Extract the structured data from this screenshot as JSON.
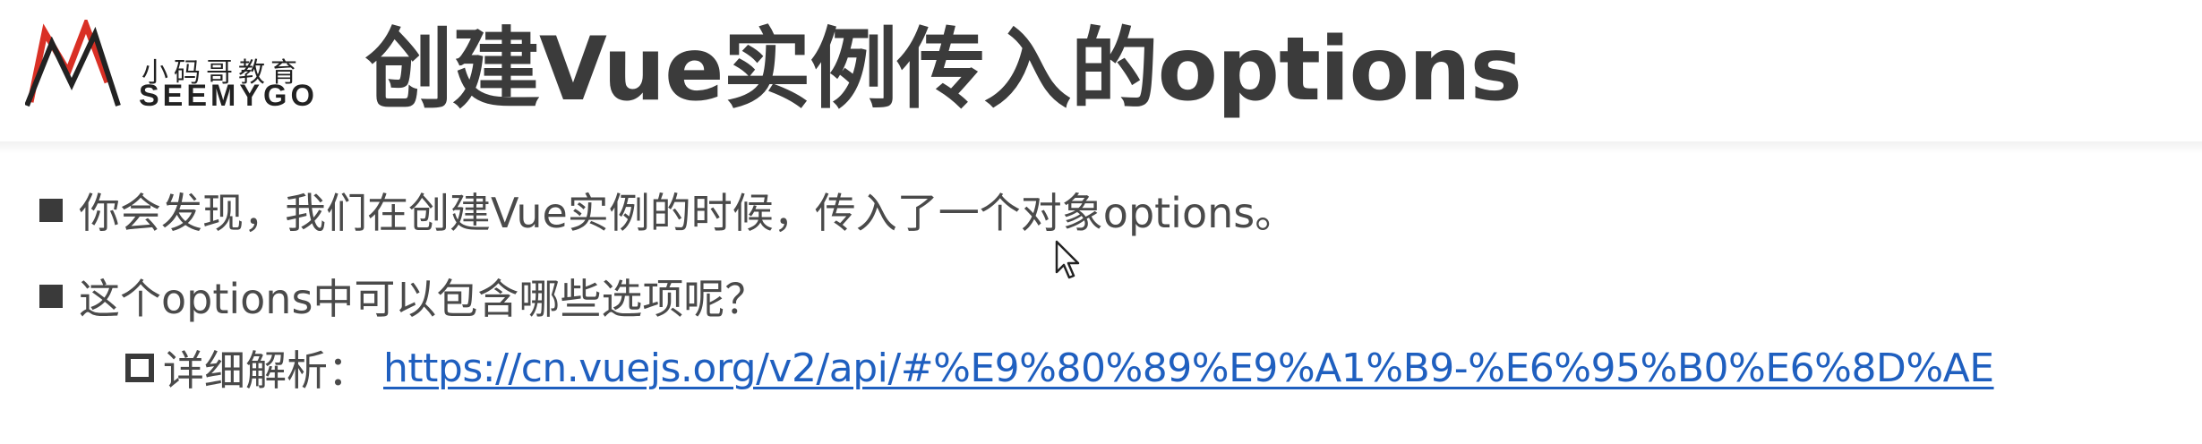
{
  "header": {
    "logo": {
      "cn_text": "小码哥教育",
      "en_text": "SEEMYGO",
      "icon": "seemygo-logo-icon"
    },
    "title": "创建Vue实例传入的options"
  },
  "bullets": [
    {
      "level": 1,
      "marker": "filled-square",
      "text": "你会发现，我们在创建Vue实例的时候，传入了一个对象options。"
    },
    {
      "level": 1,
      "marker": "filled-square",
      "text": "这个options中可以包含哪些选项呢？"
    },
    {
      "level": 2,
      "marker": "hollow-square",
      "label": "详细解析：",
      "link": "https://cn.vuejs.org/v2/api/#%E9%80%89%E9%A1%B9-%E6%95%B0%E6%8D%AE"
    }
  ],
  "colors": {
    "title": "#3b3b3b",
    "text": "#4a4a4a",
    "link": "#1f5fbf",
    "logo_red": "#d93025",
    "logo_dark": "#222222"
  },
  "cursor": {
    "icon": "mouse-pointer-icon"
  }
}
